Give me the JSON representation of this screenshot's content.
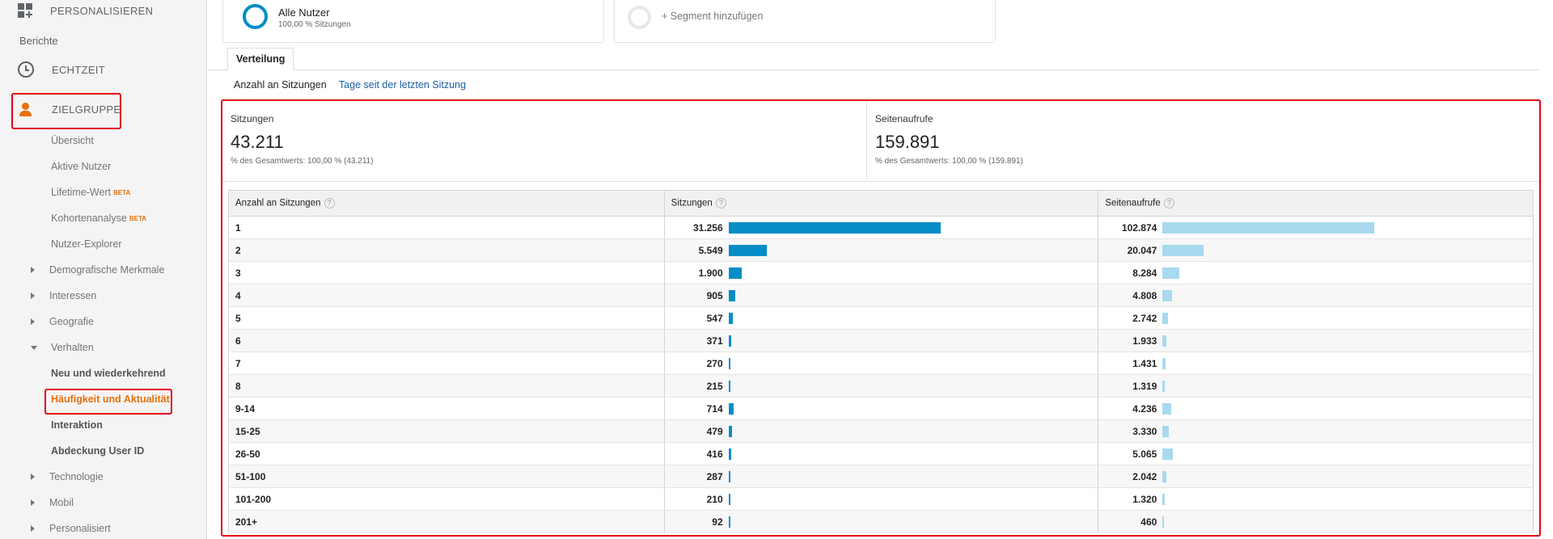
{
  "sidebar": {
    "top_item": "PERSONALISIEREN",
    "section": "Berichte",
    "echtzeit": "ECHTZEIT",
    "zielgruppe": "ZIELGRUPPE",
    "items": [
      {
        "label": "Übersicht"
      },
      {
        "label": "Aktive Nutzer"
      },
      {
        "label": "Lifetime-Wert",
        "badge": "BETA"
      },
      {
        "label": "Kohortenanalyse",
        "badge": "BETA"
      },
      {
        "label": "Nutzer-Explorer"
      }
    ],
    "groups": [
      {
        "label": "Demografische Merkmale"
      },
      {
        "label": "Interessen"
      },
      {
        "label": "Geografie"
      },
      {
        "label": "Verhalten"
      }
    ],
    "verhalten_items": [
      {
        "label": "Neu und wiederkehrend"
      },
      {
        "label": "Häufigkeit und Aktualität"
      },
      {
        "label": "Interaktion"
      },
      {
        "label": "Abdeckung User ID"
      }
    ],
    "groups_after": [
      {
        "label": "Technologie"
      },
      {
        "label": "Mobil"
      },
      {
        "label": "Personalisiert"
      }
    ]
  },
  "segments": {
    "active": {
      "title": "Alle Nutzer",
      "subtitle": "100,00 % Sitzungen"
    },
    "add_label": "+ Segment hinzufügen"
  },
  "tab": "Verteilung",
  "subtabs": {
    "active": "Anzahl an Sitzungen",
    "link": "Tage seit der letzten Sitzung"
  },
  "scorecards": [
    {
      "label": "Sitzungen",
      "value": "43.211",
      "sub": "% des Gesamtwerts: 100,00 % (43.211)"
    },
    {
      "label": "Seitenaufrufe",
      "value": "159.891",
      "sub": "% des Gesamtwerts: 100,00 % (159.891)"
    }
  ],
  "table": {
    "headers": [
      "Anzahl an Sitzungen",
      "Sitzungen",
      "Seitenaufrufe"
    ],
    "help_icon": "?",
    "rows": [
      {
        "dim": "1",
        "sessions": "31.256",
        "s": 31256,
        "pageviews": "102.874",
        "p": 102874
      },
      {
        "dim": "2",
        "sessions": "5.549",
        "s": 5549,
        "pageviews": "20.047",
        "p": 20047
      },
      {
        "dim": "3",
        "sessions": "1.900",
        "s": 1900,
        "pageviews": "8.284",
        "p": 8284
      },
      {
        "dim": "4",
        "sessions": "905",
        "s": 905,
        "pageviews": "4.808",
        "p": 4808
      },
      {
        "dim": "5",
        "sessions": "547",
        "s": 547,
        "pageviews": "2.742",
        "p": 2742
      },
      {
        "dim": "6",
        "sessions": "371",
        "s": 371,
        "pageviews": "1.933",
        "p": 1933
      },
      {
        "dim": "7",
        "sessions": "270",
        "s": 270,
        "pageviews": "1.431",
        "p": 1431
      },
      {
        "dim": "8",
        "sessions": "215",
        "s": 215,
        "pageviews": "1.319",
        "p": 1319
      },
      {
        "dim": "9-14",
        "sessions": "714",
        "s": 714,
        "pageviews": "4.236",
        "p": 4236
      },
      {
        "dim": "15-25",
        "sessions": "479",
        "s": 479,
        "pageviews": "3.330",
        "p": 3330
      },
      {
        "dim": "26-50",
        "sessions": "416",
        "s": 416,
        "pageviews": "5.065",
        "p": 5065
      },
      {
        "dim": "51-100",
        "sessions": "287",
        "s": 287,
        "pageviews": "2.042",
        "p": 2042
      },
      {
        "dim": "101-200",
        "sessions": "210",
        "s": 210,
        "pageviews": "1.320",
        "p": 1320
      },
      {
        "dim": "201+",
        "sessions": "92",
        "s": 92,
        "pageviews": "460",
        "p": 460
      }
    ]
  },
  "colors": {
    "sessions_bar": "#058dc7",
    "pageviews_bar": "#a8d9ef",
    "accent": "#e8710a",
    "highlight": "#e2001a"
  }
}
